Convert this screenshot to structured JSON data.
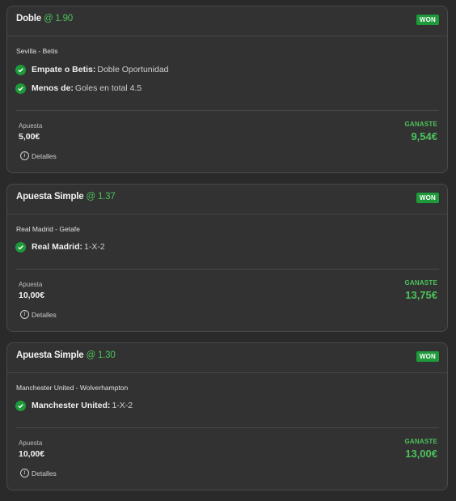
{
  "bets": [
    {
      "type": "Doble",
      "odds": "@ 1.90",
      "status": "WON",
      "event": "Sevilla - Betis",
      "selections": [
        {
          "name": "Empate o Betis:",
          "market": "Doble Oportunidad"
        },
        {
          "name": "Menos de:",
          "market": "Goles en total 4.5"
        }
      ],
      "stake_label": "Apuesta",
      "stake": "5,00€",
      "win_label": "GANASTE",
      "win": "9,54€",
      "details_label": "Detalles"
    },
    {
      "type": "Apuesta Simple",
      "odds": "@ 1.37",
      "status": "WON",
      "event": "Real Madrid - Getafe",
      "selections": [
        {
          "name": "Real Madrid:",
          "market": "1-X-2"
        }
      ],
      "stake_label": "Apuesta",
      "stake": "10,00€",
      "win_label": "GANASTE",
      "win": "13,75€",
      "details_label": "Detalles"
    },
    {
      "type": "Apuesta Simple",
      "odds": "@ 1.30",
      "status": "WON",
      "event": "Manchester United - Wolverhampton",
      "selections": [
        {
          "name": "Manchester United:",
          "market": "1-X-2"
        }
      ],
      "stake_label": "Apuesta",
      "stake": "10,00€",
      "win_label": "GANASTE",
      "win": "13,00€",
      "details_label": "Detalles"
    }
  ],
  "colors": {
    "accent_green": "#4cc35b",
    "badge_green": "#1e9a3a",
    "card_bg": "#323232",
    "page_bg": "#2a2a2a"
  },
  "icons": {
    "selection": "check-circle-icon",
    "details": "info-icon"
  }
}
